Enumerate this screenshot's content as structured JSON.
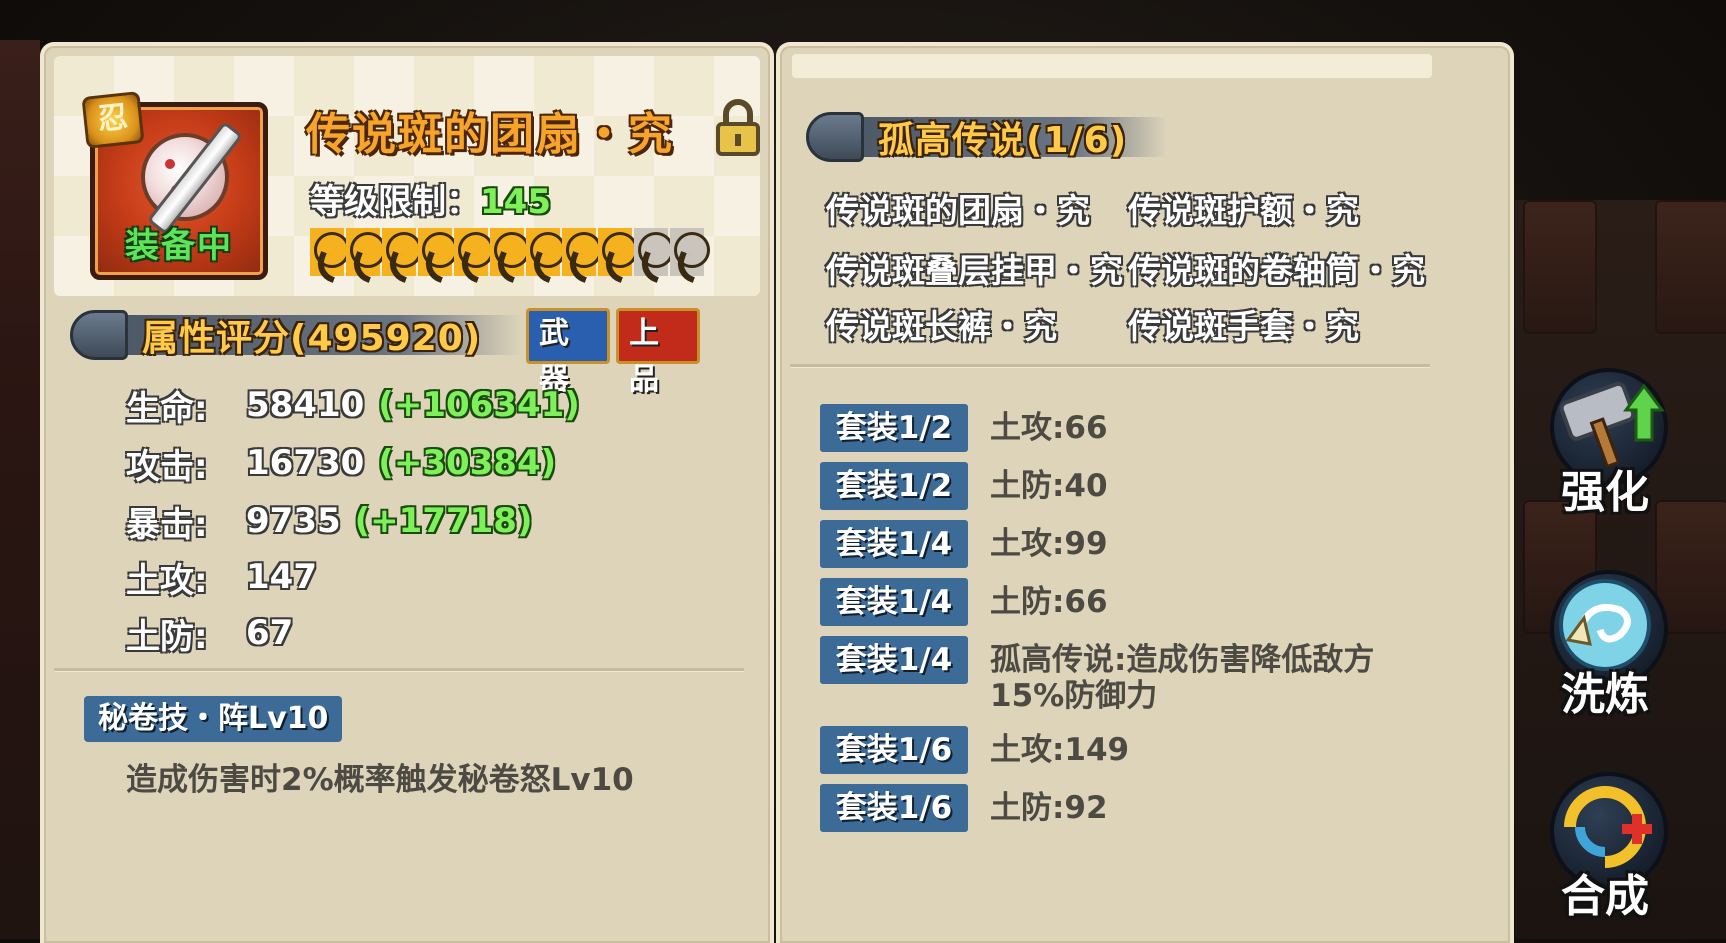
{
  "item": {
    "name": "传说斑的团扇・究",
    "status": "装备中",
    "badge_glyph": "忍",
    "level_label": "等级限制：",
    "level_value": "145",
    "stars_total": 11,
    "stars_filled": 9
  },
  "score": {
    "label": "属性评分(495920)"
  },
  "tags": {
    "type": "武器",
    "quality": "上品"
  },
  "stats": [
    {
      "label": "生命:",
      "value": "58410",
      "bonus": "(+106341)"
    },
    {
      "label": "攻击:",
      "value": "16730",
      "bonus": "(+30384)"
    },
    {
      "label": "暴击:",
      "value": "9735",
      "bonus": "(+17718)"
    },
    {
      "label": "土攻:",
      "value": "147",
      "bonus": ""
    },
    {
      "label": "土防:",
      "value": "67",
      "bonus": ""
    }
  ],
  "skill": {
    "name": "秘卷技・阵Lv10",
    "description": "造成伤害时2%概率触发秘卷怒Lv10"
  },
  "set": {
    "title": "孤高传说(1/6)",
    "members": [
      "传说斑的团扇・究",
      "传说斑护额・究",
      "传说斑叠层挂甲・究",
      "传说斑的卷轴筒・究",
      "传说斑长裤・究",
      "传说斑手套・究"
    ],
    "bonuses": [
      {
        "badge": "套装1/2",
        "text": "土攻:66"
      },
      {
        "badge": "套装1/2",
        "text": "土防:40"
      },
      {
        "badge": "套装1/4",
        "text": "土攻:99"
      },
      {
        "badge": "套装1/4",
        "text": "土防:66"
      },
      {
        "badge": "套装1/4",
        "text": "孤高传说:造成伤害降低敌方15%防御力"
      },
      {
        "badge": "套装1/6",
        "text": "土攻:149"
      },
      {
        "badge": "套装1/6",
        "text": "土防:92"
      }
    ]
  },
  "actions": {
    "enhance": "强化",
    "refine": "洗炼",
    "combine": "合成"
  },
  "colors": {
    "panel_bg": "#ddd4ba",
    "item_name": "#f7a52a",
    "bonus_green": "#7ef05a",
    "badge_blue": "#3c6b97",
    "banner_gold": "#ffc94a"
  }
}
